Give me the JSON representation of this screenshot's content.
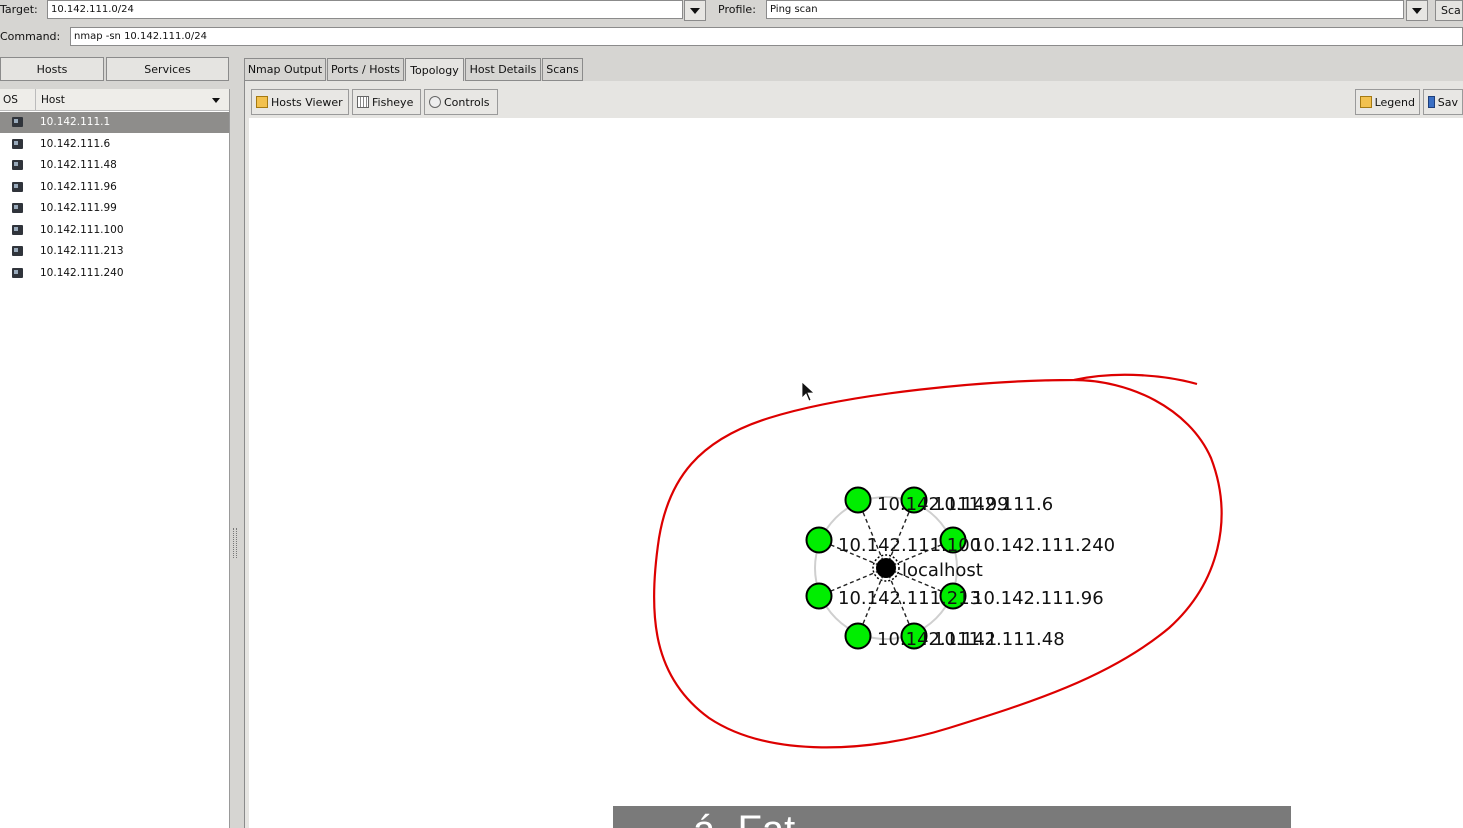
{
  "target": {
    "label": "Target:",
    "value": "10.142.111.0/24"
  },
  "profile": {
    "label": "Profile:",
    "value": "Ping scan"
  },
  "scan_button": "Sca",
  "command": {
    "label": "Command:",
    "value": "nmap -sn 10.142.111.0/24"
  },
  "left_tabs": [
    "Hosts",
    "Services"
  ],
  "host_list": {
    "col_os": "OS",
    "col_host": "Host",
    "hosts": [
      "10.142.111.1",
      "10.142.111.6",
      "10.142.111.48",
      "10.142.111.96",
      "10.142.111.99",
      "10.142.111.100",
      "10.142.111.213",
      "10.142.111.240"
    ],
    "selected": "10.142.111.1"
  },
  "main_tabs": [
    "Nmap Output",
    "Ports / Hosts",
    "Topology",
    "Host Details",
    "Scans"
  ],
  "active_tab": "Topology",
  "toolbar": {
    "hosts_viewer": "Hosts Viewer",
    "fisheye": "Fisheye",
    "controls": "Controls",
    "legend": "Legend",
    "save": "Sav"
  },
  "topology": {
    "center_label": "localhost",
    "node_labels": {
      "n1": "10.142.111.99",
      "n2": "10.142.111.6",
      "n3": "10.142.111.100",
      "n4": "10.142.111.240",
      "n5": "10.142.111.213",
      "n6": "10.142.111.96",
      "n7": "10.142.111.1",
      "n8": "10.142.111.48"
    },
    "node_color": "#00ee00",
    "annotation_color": "#dd0000"
  },
  "overlay_text": "á  Fat"
}
